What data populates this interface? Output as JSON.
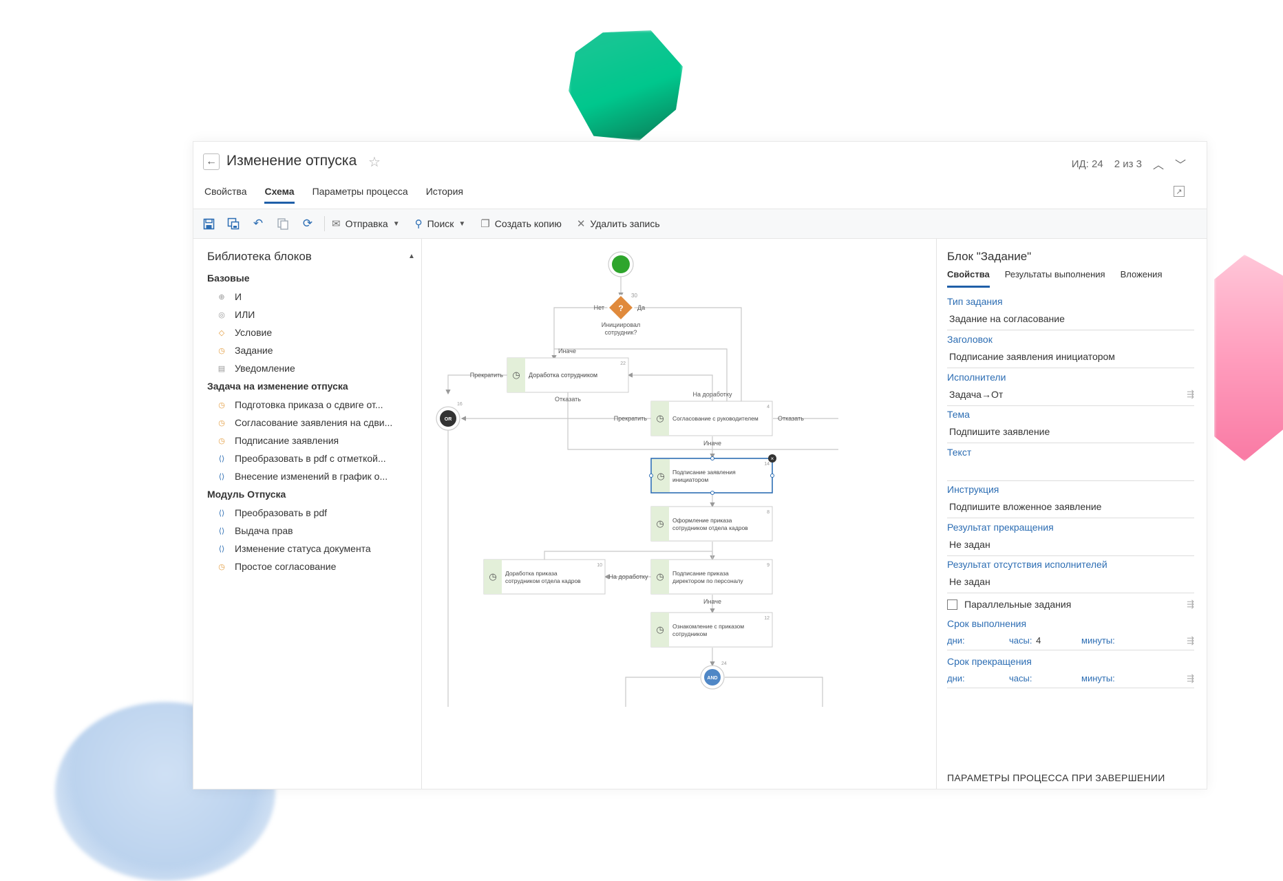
{
  "header": {
    "title": "Изменение отпуска",
    "id_label": "ИД: 24",
    "pager": "2 из 3"
  },
  "tabs": [
    "Свойства",
    "Схема",
    "Параметры процесса",
    "История"
  ],
  "toolbar": {
    "send": "Отправка",
    "search": "Поиск",
    "copy": "Создать копию",
    "delete": "Удалить запись"
  },
  "library": {
    "title": "Библиотека блоков",
    "groups": [
      {
        "name": "Базовые",
        "items": [
          {
            "label": "И",
            "icon": "and-icon"
          },
          {
            "label": "ИЛИ",
            "icon": "or-icon"
          },
          {
            "label": "Условие",
            "icon": "condition-icon"
          },
          {
            "label": "Задание",
            "icon": "task-icon"
          },
          {
            "label": "Уведомление",
            "icon": "notification-icon"
          }
        ]
      },
      {
        "name": "Задача на изменение отпуска",
        "items": [
          {
            "label": "Подготовка приказа о сдвиге от...",
            "icon": "task-icon"
          },
          {
            "label": "Согласование заявления на сдви...",
            "icon": "task-icon"
          },
          {
            "label": "Подписание заявления",
            "icon": "task-icon"
          },
          {
            "label": "Преобразовать в pdf с отметкой...",
            "icon": "script-icon"
          },
          {
            "label": "Внесение изменений в график о...",
            "icon": "script-icon"
          }
        ]
      },
      {
        "name": "Модуль Отпуска",
        "items": [
          {
            "label": "Преобразовать в pdf",
            "icon": "script-icon"
          },
          {
            "label": "Выдача прав",
            "icon": "script-icon"
          },
          {
            "label": "Изменение статуса документа",
            "icon": "script-icon"
          },
          {
            "label": "Простое согласование",
            "icon": "task-icon"
          }
        ]
      }
    ]
  },
  "diagram": {
    "condition": {
      "num": "30",
      "label1": "Инициировал",
      "label2": "сотрудник?",
      "no": "Нет",
      "yes": "Да"
    },
    "labels": {
      "inache": "Иначе",
      "prekratit": "Прекратить",
      "otkazat": "Отказать",
      "na_dorabotku": "На доработку"
    },
    "or_node": {
      "label": "OR",
      "num": "16"
    },
    "and_node": {
      "label": "AND",
      "num": "24"
    },
    "blocks": [
      {
        "num": "22",
        "line1": "Доработка сотрудником",
        "line2": ""
      },
      {
        "num": "4",
        "line1": "Согласование с руководителем",
        "line2": ""
      },
      {
        "num": "14",
        "line1": "Подписание заявления",
        "line2": "инициатором"
      },
      {
        "num": "8",
        "line1": "Оформление приказа",
        "line2": "сотрудником отдела кадров"
      },
      {
        "num": "10",
        "line1": "Доработка приказа",
        "line2": "сотрудником отдела кадров"
      },
      {
        "num": "9",
        "line1": "Подписание приказа",
        "line2": "директором по персоналу"
      },
      {
        "num": "12",
        "line1": "Ознакомление с приказом",
        "line2": "сотрудником"
      }
    ]
  },
  "props": {
    "title": "Блок \"Задание\"",
    "tabs": [
      "Свойства",
      "Результаты выполнения",
      "Вложения"
    ],
    "task_type_label": "Тип задания",
    "task_type_value": "Задание на согласование",
    "heading_label": "Заголовок",
    "heading_value": "Подписание заявления инициатором",
    "performers_label": "Исполнители",
    "performers_value": "Задача→От",
    "subject_label": "Тема",
    "subject_value": "Подпишите заявление",
    "text_label": "Текст",
    "text_value": "",
    "instruction_label": "Инструкция",
    "instruction_value": "Подпишите вложенное заявление",
    "stop_result_label": "Результат прекращения",
    "stop_result_value": "Не задан",
    "absent_result_label": "Результат отсутствия исполнителей",
    "absent_result_value": "Не задан",
    "parallel_label": "Параллельные задания",
    "deadline_label": "Срок выполнения",
    "deadline": {
      "days": "дни:",
      "hours": "часы:",
      "hours_value": "4",
      "minutes": "минуты:"
    },
    "stop_deadline_label": "Срок прекращения",
    "stop_deadline": {
      "days": "дни:",
      "hours": "часы:",
      "minutes": "минуты:"
    },
    "params_heading": "ПАРАМЕТРЫ ПРОЦЕССА ПРИ ЗАВЕРШЕНИИ"
  },
  "colors": {
    "accent": "#1f5fa8",
    "start_node": "#2ea52c",
    "condition": "#e08a3c",
    "task_bg": "#e3efd9",
    "selected": "#2c6db3"
  }
}
